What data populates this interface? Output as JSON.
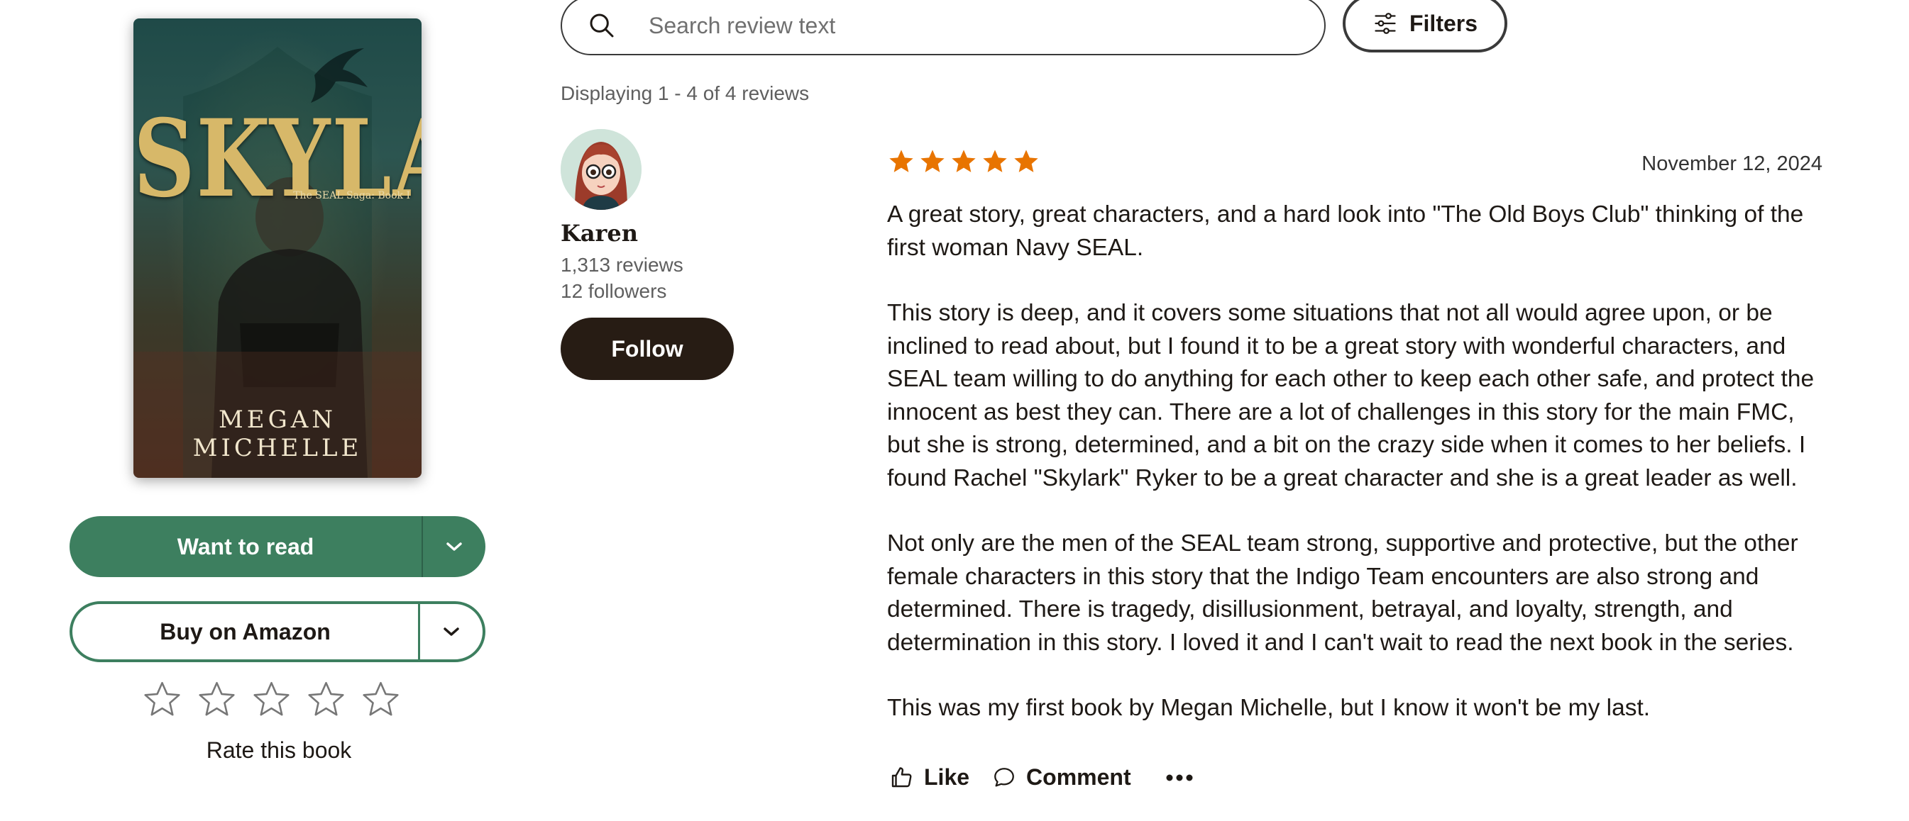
{
  "book": {
    "cover_title": "SKYLARK",
    "cover_subtitle": "The SEAL Saga: Book I",
    "cover_author": "MEGAN MICHELLE"
  },
  "shelf": {
    "want_to_read_label": "Want to read",
    "buy_label": "Buy on Amazon",
    "rate_label": "Rate this book",
    "rating_max": 5,
    "user_rating": 0
  },
  "search": {
    "placeholder": "Search review text",
    "filters_label": "Filters"
  },
  "results": {
    "displaying_text": "Displaying 1 - 4 of 4 reviews"
  },
  "reviewer": {
    "name": "Karen",
    "reviews_count": "1,313 reviews",
    "followers_count": "12 followers",
    "follow_label": "Follow"
  },
  "review": {
    "rating": 5,
    "date": "November 12, 2024",
    "paragraphs": [
      "A great story, great characters, and a hard look into \"The Old Boys Club\" thinking of the first woman Navy SEAL.",
      "This story is deep, and it covers some situations that not all would agree upon, or be inclined to read about, but I found it to be a great story with wonderful characters, and SEAL team willing to do anything for each other to keep each other safe, and protect the innocent as best they can. There are a lot of challenges in this story for the main FMC, but she is strong, determined, and a bit on the crazy side when it comes to her beliefs. I found Rachel \"Skylark\" Ryker to be a great character and she is a great leader as well.",
      "Not only are the men of the SEAL team strong, supportive and protective, but the other female characters in this story that the Indigo Team encounters are also strong and determined. There is tragedy, disillusionment, betrayal, and loyalty, strength, and determination in this story. I loved it and I can't wait to read the next book in the series.",
      "This was my first book by Megan Michelle, but I know it won't be my last."
    ],
    "like_label": "Like",
    "comment_label": "Comment"
  },
  "colors": {
    "brand_green": "#3d7f5f",
    "star_orange": "#e87400",
    "follow_dark": "#271c14"
  },
  "icons": {
    "search": "search-icon",
    "filters": "sliders-icon",
    "dropdown": "chevron-down-icon",
    "like": "thumbs-up-icon",
    "comment": "speech-bubble-icon",
    "more": "more-dots-icon"
  }
}
